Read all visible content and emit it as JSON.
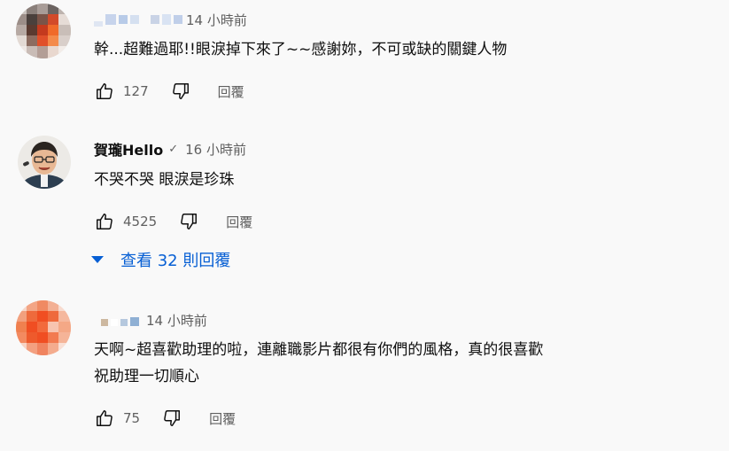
{
  "comments": [
    {
      "author": "",
      "verified": false,
      "time": "14 小時前",
      "text_lines": [
        "幹...超難過耶!!眼淚掉下來了~~感謝妳，不可或缺的關鍵人物"
      ],
      "likes": "127",
      "reply_label": "回覆"
    },
    {
      "author": "賀瓏Hello",
      "verified": true,
      "verified_mark": "✓",
      "time": "16 小時前",
      "text_lines": [
        "不哭不哭 眼淚是珍珠"
      ],
      "likes": "4525",
      "reply_label": "回覆",
      "replies_toggle": "查看 32 則回覆"
    },
    {
      "author": "",
      "verified": false,
      "time": "14 小時前",
      "text_lines": [
        "天啊~超喜歡助理的啦，連離職影片都很有你們的風格，真的很喜歡",
        "祝助理一切順心"
      ],
      "likes": "75",
      "reply_label": "回覆"
    }
  ],
  "colors": {
    "background": "#f9f9f9",
    "secondary_text": "#606060",
    "link_blue": "#065fd4"
  },
  "icons": [
    "thumbs-up-icon",
    "thumbs-down-icon",
    "chevron-down-icon",
    "verified-check-icon"
  ]
}
